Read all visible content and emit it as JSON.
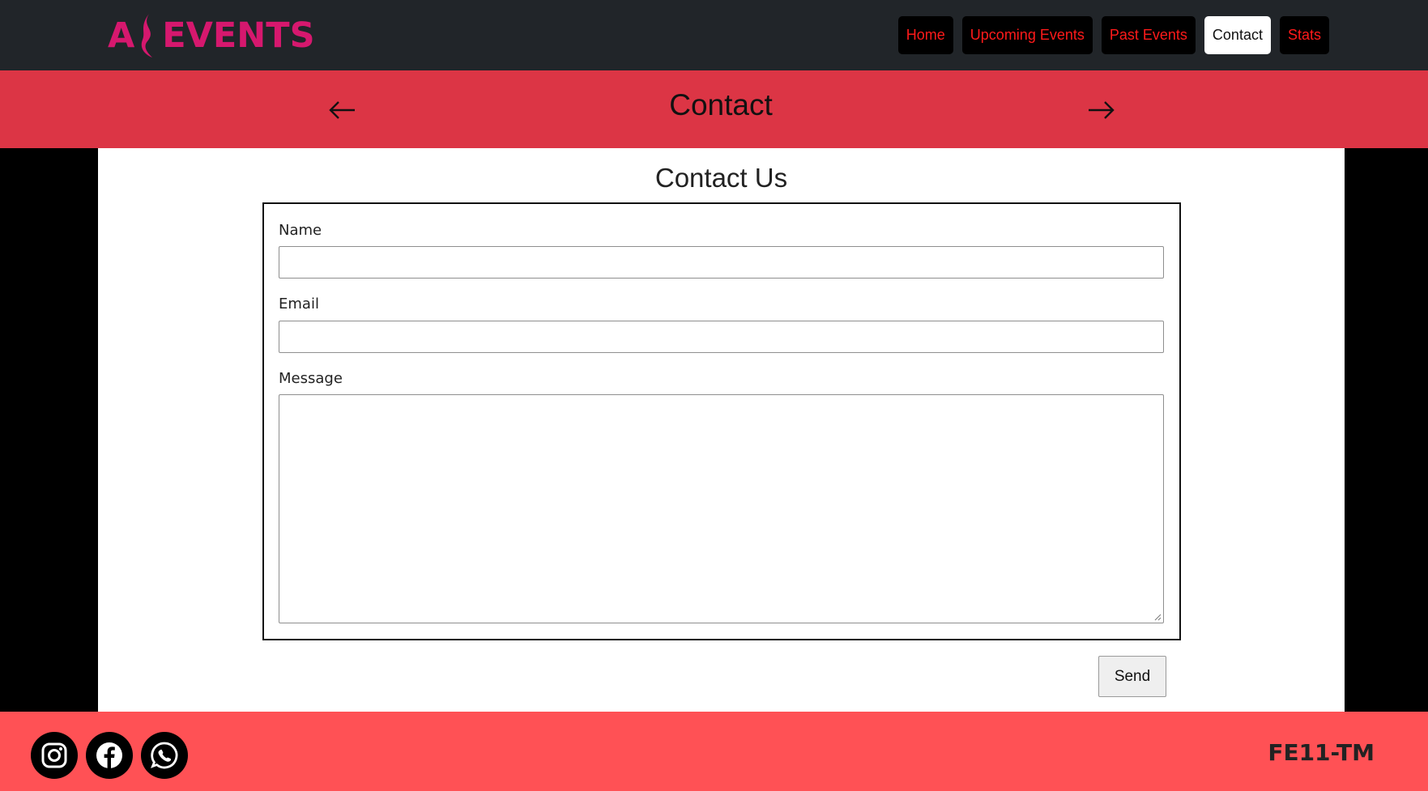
{
  "header": {
    "logo_text_left": "A",
    "logo_text_right": "EVENTS",
    "nav": [
      {
        "label": "Home",
        "active": false
      },
      {
        "label": "Upcoming Events",
        "active": false
      },
      {
        "label": "Past Events",
        "active": false
      },
      {
        "label": "Contact",
        "active": true
      },
      {
        "label": "Stats",
        "active": false
      }
    ]
  },
  "band": {
    "title": "Contact",
    "prev_icon": "arrow-left-icon",
    "next_icon": "arrow-right-icon"
  },
  "form": {
    "heading": "Contact Us",
    "name_label": "Name",
    "name_value": "",
    "email_label": "Email",
    "email_value": "",
    "message_label": "Message",
    "message_value": "",
    "send_label": "Send"
  },
  "footer": {
    "socials": [
      "instagram-icon",
      "facebook-icon",
      "whatsapp-icon"
    ],
    "code": "FE11-TM"
  },
  "colors": {
    "topbar": "#212529",
    "band": "#dc3545",
    "footer": "#ff5155",
    "brand": "#d6186e",
    "nav_text": "#ff1a1a"
  }
}
